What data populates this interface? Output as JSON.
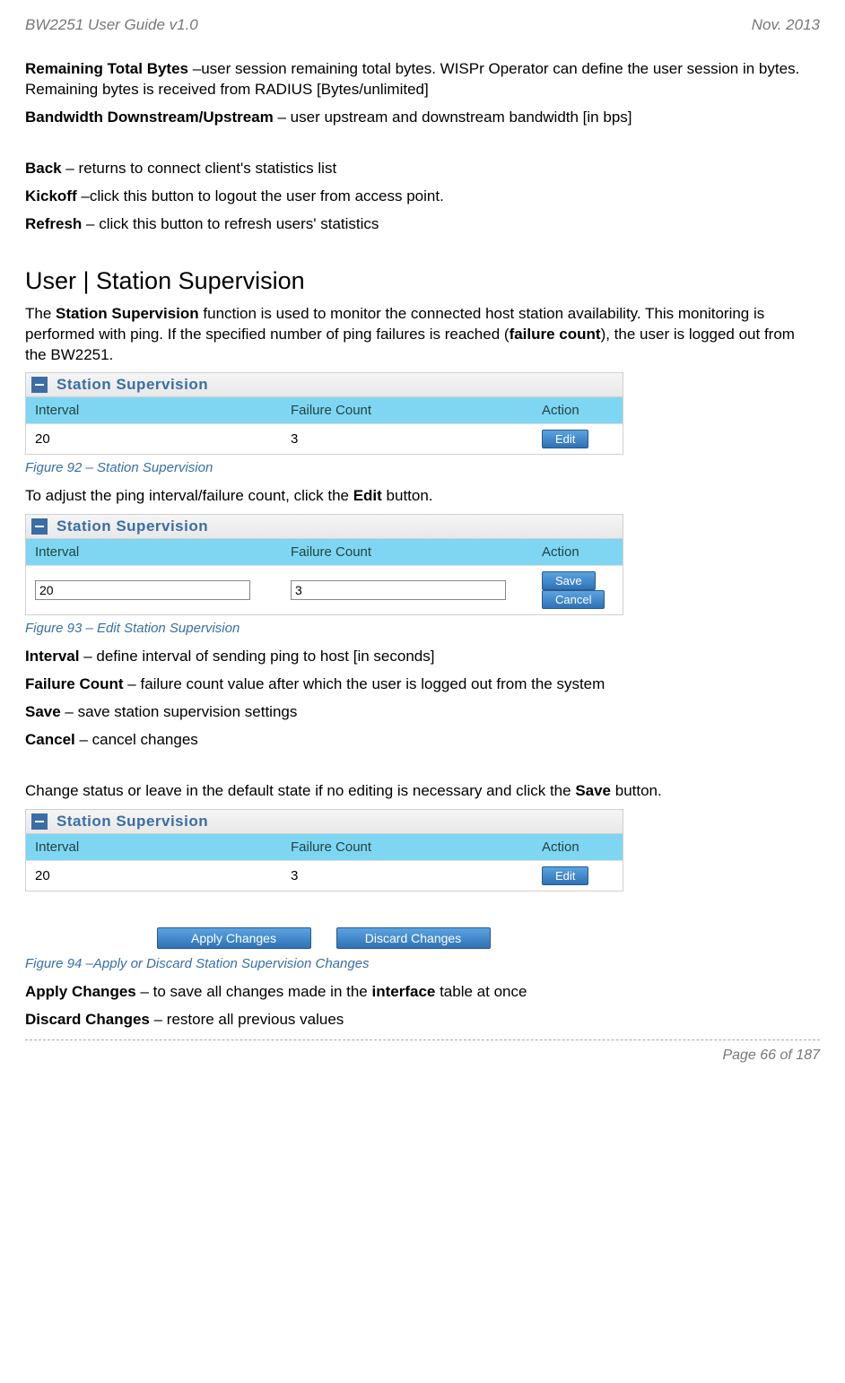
{
  "header": {
    "left": "BW2251 User Guide v1.0",
    "right": "Nov.  2013"
  },
  "defs": {
    "remaining_total_bytes": {
      "term": "Remaining Total Bytes",
      "sep": " –",
      "desc": "user session remaining total bytes. WISPr Operator can define the user session in bytes. Remaining bytes is received from RADIUS [Bytes/unlimited]"
    },
    "bandwidth": {
      "term": "Bandwidth Downstream/Upstream",
      "sep": " – ",
      "desc": "user upstream and downstream bandwidth [in bps]"
    },
    "back": {
      "term": "Back",
      "sep": " – ",
      "desc": "returns to connect client's statistics list"
    },
    "kickoff": {
      "term": "Kickoff",
      "sep": " –",
      "desc": "click this button to logout the user from access point."
    },
    "refresh": {
      "term": "Refresh",
      "sep": " – ",
      "desc": "click this button to refresh users' statistics"
    },
    "interval": {
      "term": "Interval",
      "sep": " – ",
      "desc": "define interval of sending ping to host [in seconds]"
    },
    "failure_count": {
      "term": "Failure Count",
      "sep": " – ",
      "desc": "failure count value after which the user is logged out from the system"
    },
    "save": {
      "term": "Save",
      "sep": " – ",
      "desc": "save station supervision settings"
    },
    "cancel": {
      "term": "Cancel",
      "sep": " – ",
      "desc": "cancel changes"
    },
    "apply_changes": {
      "term": "Apply Changes",
      "sep": " – ",
      "desc_pre": "to save all changes made in the ",
      "desc_bold": "interface",
      "desc_post": " table at once"
    },
    "discard_changes": {
      "term": "Discard Changes",
      "sep": " – ",
      "desc": "restore all previous values"
    }
  },
  "section": {
    "title": "User | Station Supervision",
    "intro_pre": "The ",
    "intro_b1": "Station Supervision",
    "intro_mid": " function is used to monitor the connected host station availability. This monitoring is performed with ping. If the specified number of ping failures is reached (",
    "intro_b2": "failure count",
    "intro_post": "), the user is logged out from the BW2251.",
    "edit_sentence_pre": "To adjust the ping interval/failure count, click the ",
    "edit_sentence_b": "Edit",
    "edit_sentence_post": " button.",
    "change_sentence_pre": "Change status or leave in the default state if no editing is necessary and click the ",
    "change_sentence_b": "Save",
    "change_sentence_post": " button."
  },
  "panel": {
    "title": "Station Supervision",
    "cols": {
      "interval": "Interval",
      "failure": "Failure Count",
      "action": "Action"
    },
    "row": {
      "interval": "20",
      "failure": "3"
    },
    "buttons": {
      "edit": "Edit",
      "save": "Save",
      "cancel": "Cancel",
      "apply": "Apply Changes",
      "discard": "Discard Changes"
    }
  },
  "captions": {
    "fig92": "Figure 92 – Station Supervision",
    "fig93": "Figure 93 – Edit Station Supervision",
    "fig94": "Figure 94 –Apply or Discard Station Supervision Changes"
  },
  "footer": "Page 66 of 187"
}
